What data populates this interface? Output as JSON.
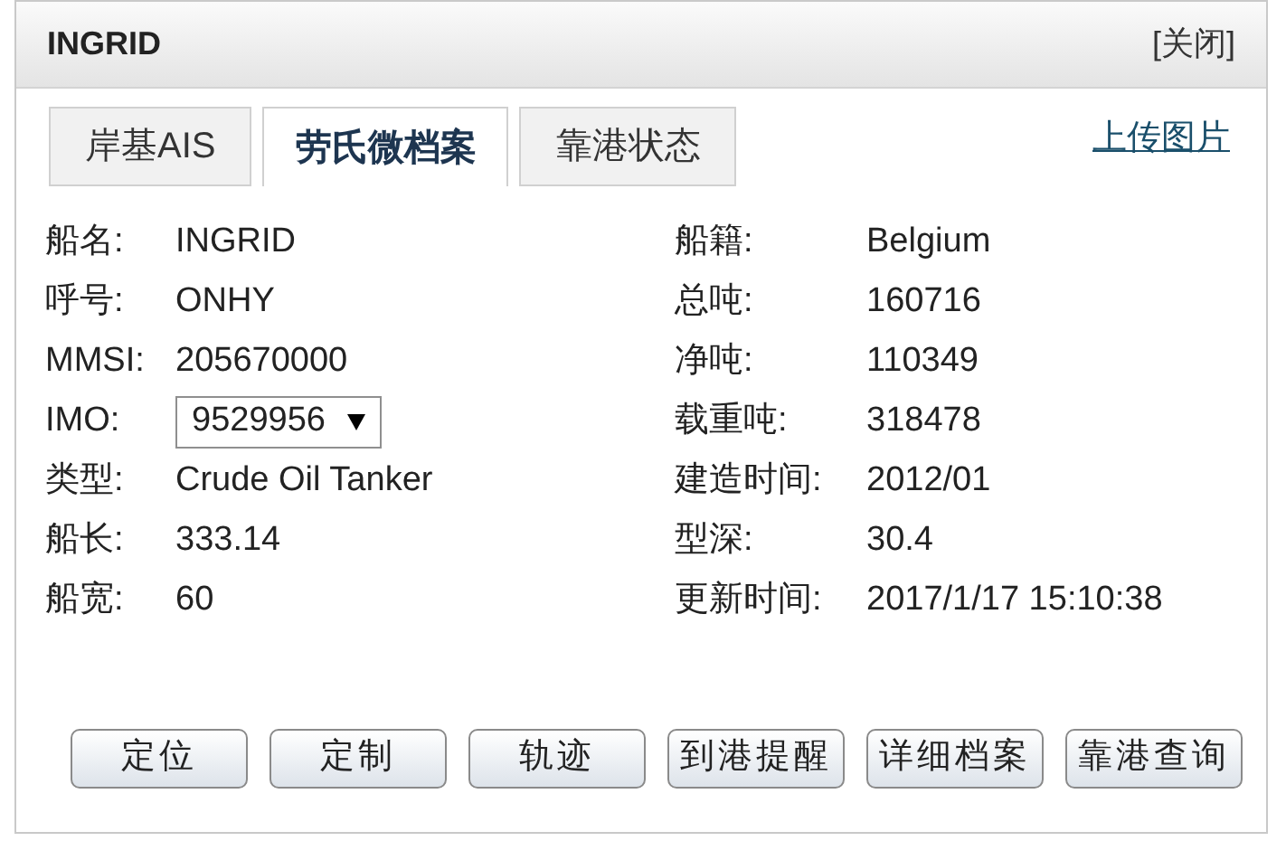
{
  "window": {
    "title": "INGRID",
    "close": "[关闭]"
  },
  "tabs": [
    {
      "label": "岸基AIS",
      "selected": false
    },
    {
      "label": "劳氏微档案",
      "selected": true
    },
    {
      "label": "靠港状态",
      "selected": false
    }
  ],
  "upload_link": "上传图片",
  "left_fields": [
    {
      "label": "船名:",
      "value": "INGRID",
      "kind": "text"
    },
    {
      "label": "呼号:",
      "value": "ONHY",
      "kind": "text"
    },
    {
      "label": "MMSI:",
      "value": "205670000",
      "kind": "text"
    },
    {
      "label": "IMO:",
      "value": "9529956",
      "kind": "select"
    },
    {
      "label": "类型:",
      "value": "Crude Oil Tanker",
      "kind": "text"
    },
    {
      "label": "船长:",
      "value": "333.14",
      "kind": "text"
    },
    {
      "label": "船宽:",
      "value": "60",
      "kind": "text"
    }
  ],
  "right_fields": [
    {
      "label": "船籍:",
      "value": "Belgium",
      "kind": "text"
    },
    {
      "label": "总吨:",
      "value": "160716",
      "kind": "text"
    },
    {
      "label": "净吨:",
      "value": "110349",
      "kind": "text"
    },
    {
      "label": "载重吨:",
      "value": "318478",
      "kind": "text"
    },
    {
      "label": "建造时间:",
      "value": "2012/01",
      "kind": "text"
    },
    {
      "label": "型深:",
      "value": "30.4",
      "kind": "text"
    },
    {
      "label": "更新时间:",
      "value": "2017/1/17 15:10:38",
      "kind": "text"
    }
  ],
  "buttons": [
    "定位",
    "定制",
    "轨迹",
    "到港提醒",
    "详细档案",
    "靠港查询"
  ]
}
